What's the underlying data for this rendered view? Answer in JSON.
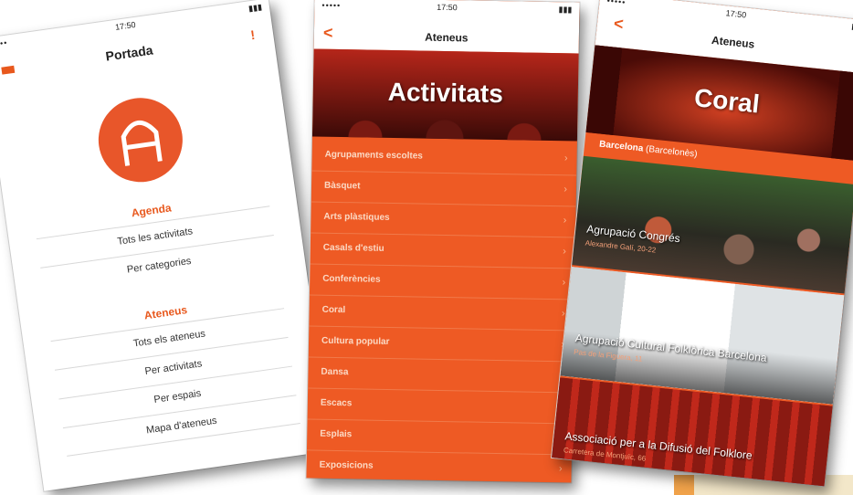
{
  "screen1": {
    "status": {
      "carrier": "••••• ",
      "time": "17:50",
      "battery": "▮▮▮"
    },
    "title": "Portada",
    "info_icon": "!",
    "sections": [
      {
        "label": "Agenda",
        "items": [
          "Tots les activitats",
          "Per categories"
        ]
      },
      {
        "label": "Ateneus",
        "items": [
          "Tots els ateneus",
          "Per activitats",
          "Per espais",
          "Mapa d'ateneus"
        ]
      }
    ]
  },
  "screen2": {
    "status": {
      "carrier": "••••• ",
      "time": "17:50",
      "battery": "▮▮▮"
    },
    "back": "<",
    "title": "Ateneus",
    "hero_title": "Activitats",
    "chevron": "›",
    "items": [
      "Agrupaments escoltes",
      "Bàsquet",
      "Arts plàstiques",
      "Casals d'estiu",
      "Conferències",
      "Coral",
      "Cultura popular",
      "Dansa",
      "Escacs",
      "Esplais",
      "Exposicions"
    ]
  },
  "screen3": {
    "status": {
      "carrier": "••••• ",
      "time": "17:50",
      "battery": "▮▮▮"
    },
    "back": "<",
    "title": "Ateneus",
    "hero_title": "Coral",
    "city_bold": "Barcelona",
    "city_rest": " (Barcelonès)",
    "cards": [
      {
        "title": "Agrupació Congrés",
        "subtitle": "Alexandre Galí, 20-22"
      },
      {
        "title": "Agrupació Cultural Folklòrica Barcelona",
        "subtitle": "Pas de la Figuera, 11"
      },
      {
        "title": "Associació per a la Difusió del Folklore",
        "subtitle": "Carretera de Montjuïc, 66"
      }
    ]
  },
  "colors": {
    "accent": "#e8581d",
    "orange_bg": "#ee5a24"
  }
}
